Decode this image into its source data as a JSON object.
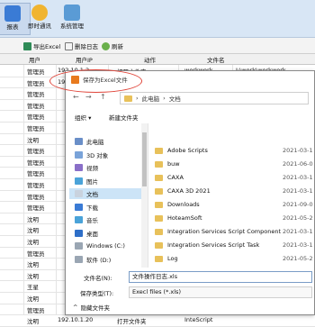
{
  "app_toolbar": {
    "buttons": [
      {
        "label": "报表"
      },
      {
        "label": "即时通讯"
      },
      {
        "label": "系统管理"
      }
    ]
  },
  "sub_toolbar": {
    "export_excel": "导出Excel",
    "delete_log": "删除日志",
    "refresh": "刷新"
  },
  "grid": {
    "headers": [
      "用户",
      "用户IP",
      "动作",
      "文件名"
    ],
    "rows": [
      {
        "user": "管理员",
        "ip": "192.10.1.2",
        "action": "打开文件夹",
        "file": "workwork",
        "extra": "I:\\work\\workwork"
      },
      {
        "user": "管理员",
        "ip": "192",
        "action": "",
        "file": "",
        "extra": ""
      },
      {
        "user": "管理员",
        "ip": "",
        "action": "",
        "file": "",
        "extra": ""
      },
      {
        "user": "管理员",
        "ip": "",
        "action": "",
        "file": "",
        "extra": ""
      },
      {
        "user": "管理员",
        "ip": "",
        "action": "",
        "file": "",
        "extra": ""
      },
      {
        "user": "管理员",
        "ip": "",
        "action": "",
        "file": "",
        "extra": ""
      },
      {
        "user": "沈明",
        "ip": "",
        "action": "",
        "file": "",
        "extra": ""
      },
      {
        "user": "管理员",
        "ip": "",
        "action": "",
        "file": "",
        "extra": ""
      },
      {
        "user": "管理员",
        "ip": "",
        "action": "",
        "file": "",
        "extra": ""
      },
      {
        "user": "管理员",
        "ip": "",
        "action": "",
        "file": "",
        "extra": ""
      },
      {
        "user": "管理员",
        "ip": "",
        "action": "",
        "file": "",
        "extra": ""
      },
      {
        "user": "管理员",
        "ip": "",
        "action": "",
        "file": "",
        "extra": ""
      },
      {
        "user": "管理员",
        "ip": "",
        "action": "",
        "file": "",
        "extra": ""
      },
      {
        "user": "沈明",
        "ip": "",
        "action": "",
        "file": "",
        "extra": ""
      },
      {
        "user": "沈明",
        "ip": "",
        "action": "",
        "file": "",
        "extra": ""
      },
      {
        "user": "沈明",
        "ip": "",
        "action": "",
        "file": "",
        "extra": ""
      },
      {
        "user": "管理员",
        "ip": "",
        "action": "",
        "file": "",
        "extra": ""
      },
      {
        "user": "沈明",
        "ip": "",
        "action": "",
        "file": "",
        "extra": ""
      },
      {
        "user": "沈明",
        "ip": "",
        "action": "",
        "file": "",
        "extra": ""
      },
      {
        "user": "王星",
        "ip": "",
        "action": "",
        "file": "",
        "extra": ""
      },
      {
        "user": "沈明",
        "ip": "",
        "action": "",
        "file": "",
        "extra": ""
      },
      {
        "user": "管理员",
        "ip": "",
        "action": "",
        "file": "",
        "extra": ""
      },
      {
        "user": "沈明",
        "ip": "192.10.1.20",
        "action": "打开文件夹",
        "file": "InteScript",
        "extra": ""
      }
    ]
  },
  "dialog": {
    "title": "保存为Excel文件",
    "breadcrumb": [
      "此电脑",
      "文档"
    ],
    "organize": "组织 ▾",
    "new_folder": "新建文件夹",
    "nav_items": [
      {
        "label": "此电脑",
        "icon": "computer-icon"
      },
      {
        "label": "3D 对象",
        "icon": "cube-icon"
      },
      {
        "label": "视频",
        "icon": "video-icon"
      },
      {
        "label": "图片",
        "icon": "image-icon"
      },
      {
        "label": "文档",
        "icon": "document-icon"
      },
      {
        "label": "下载",
        "icon": "download-icon"
      },
      {
        "label": "音乐",
        "icon": "music-icon"
      },
      {
        "label": "桌面",
        "icon": "desktop-icon"
      },
      {
        "label": "Windows (C:)",
        "icon": "drive-icon"
      },
      {
        "label": "软件 (D:)",
        "icon": "drive-icon"
      }
    ],
    "files": [
      {
        "name": "Adobe Scripts",
        "date": "2021-03-1"
      },
      {
        "name": "buw",
        "date": "2021-06-0"
      },
      {
        "name": "CAXA",
        "date": "2021-03-1"
      },
      {
        "name": "CAXA 3D 2021",
        "date": "2021-03-1"
      },
      {
        "name": "Downloads",
        "date": "2021-09-0"
      },
      {
        "name": "HoteamSoft",
        "date": "2021-05-2"
      },
      {
        "name": "Integration Services Script Component",
        "date": "2021-03-1"
      },
      {
        "name": "Integration Services Script Task",
        "date": "2021-03-1"
      },
      {
        "name": "Log",
        "date": "2021-05-2"
      }
    ],
    "filename_label": "文件名(N):",
    "filename_value": "文件操作日志.xls",
    "filetype_label": "保存类型(T):",
    "filetype_value": "Execl files (*.xls)",
    "hide_folders": "隐藏文件夹"
  },
  "colors": {
    "accent": "#e87a1e",
    "highlight": "#e0453a",
    "selection": "#cce4f7"
  }
}
